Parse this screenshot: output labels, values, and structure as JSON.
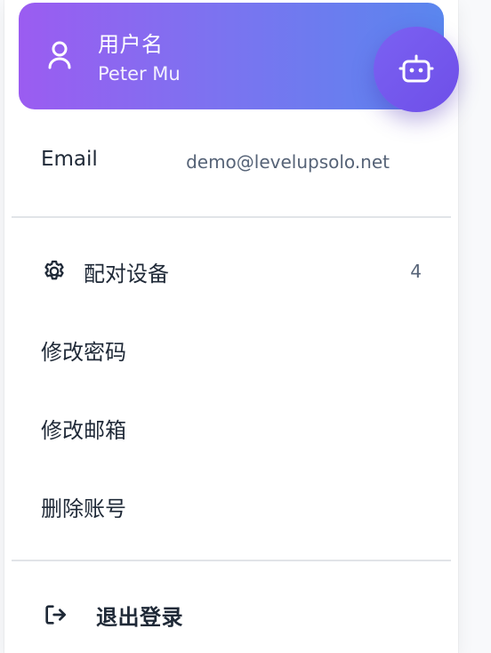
{
  "profile": {
    "username_label": "用户名",
    "username": "Peter Mu",
    "user_icon": "user-icon",
    "bot_icon": "robot-icon",
    "gradient_start": "#9b5cf1",
    "gradient_end": "#5a86ee"
  },
  "account": {
    "email_label": "Email",
    "email_value": "demo@levelupsolo.net"
  },
  "menu": {
    "paired_devices_label": "配对设备",
    "paired_devices_icon": "gear-icon",
    "paired_devices_count": "4",
    "change_password_label": "修改密码",
    "change_email_label": "修改邮箱",
    "delete_account_label": "删除账号"
  },
  "logout": {
    "label": "退出登录",
    "icon": "logout-icon"
  }
}
